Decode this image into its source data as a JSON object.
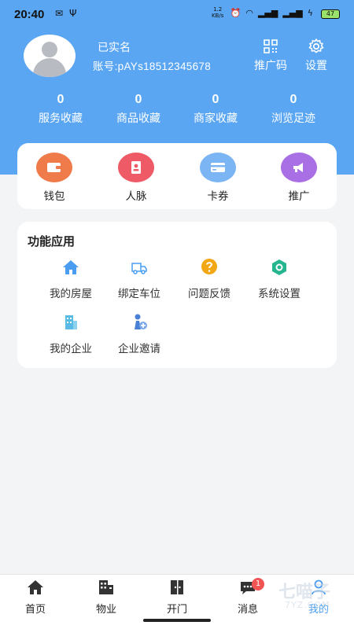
{
  "status_bar": {
    "time": "20:40",
    "network_speed": "1.2 KB/s",
    "battery": "47"
  },
  "profile": {
    "real_name_status": "已实名",
    "account": "账号:pAYs18512345678"
  },
  "header_actions": {
    "promo_code": "推广码",
    "settings": "设置"
  },
  "stats": [
    {
      "value": "0",
      "label": "服务收藏"
    },
    {
      "value": "0",
      "label": "商品收藏"
    },
    {
      "value": "0",
      "label": "商家收藏"
    },
    {
      "value": "0",
      "label": "浏览足迹"
    }
  ],
  "quick_actions": [
    {
      "label": "钱包",
      "icon": "wallet-icon",
      "color": "#f07b4a"
    },
    {
      "label": "人脉",
      "icon": "contacts-icon",
      "color": "#ee5b66"
    },
    {
      "label": "卡券",
      "icon": "card-icon",
      "color": "#7cb5f4"
    },
    {
      "label": "推广",
      "icon": "megaphone-icon",
      "color": "#a970e6"
    }
  ],
  "functions": {
    "title": "功能应用",
    "items": [
      {
        "label": "我的房屋",
        "icon": "house-icon"
      },
      {
        "label": "绑定车位",
        "icon": "truck-icon"
      },
      {
        "label": "问题反馈",
        "icon": "question-icon"
      },
      {
        "label": "系统设置",
        "icon": "settings-icon"
      },
      {
        "label": "我的企业",
        "icon": "building-icon"
      },
      {
        "label": "企业邀请",
        "icon": "invite-icon"
      }
    ]
  },
  "tabbar": {
    "items": [
      {
        "label": "首页",
        "icon": "home-icon"
      },
      {
        "label": "物业",
        "icon": "property-icon"
      },
      {
        "label": "开门",
        "icon": "door-icon"
      },
      {
        "label": "消息",
        "icon": "message-icon",
        "badge": "1"
      },
      {
        "label": "我的",
        "icon": "user-icon"
      }
    ]
  },
  "watermark": {
    "brand": "七喵子",
    "site": "7YZ.COM"
  },
  "colors": {
    "header": "#5aa6f2",
    "accent": "#4a9df0"
  }
}
